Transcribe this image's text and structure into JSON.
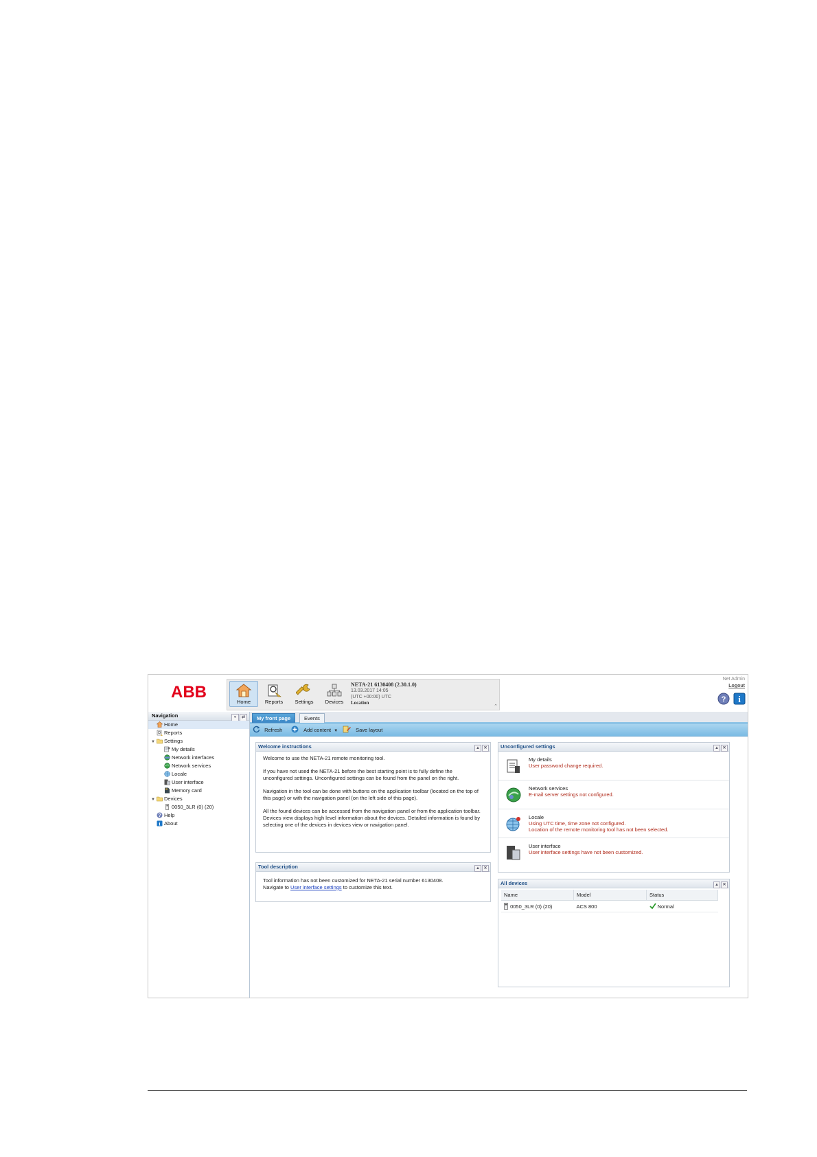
{
  "header": {
    "logo": "ABB",
    "toolbar": [
      {
        "label": "Home",
        "icon": "home-icon"
      },
      {
        "label": "Reports",
        "icon": "reports-icon"
      },
      {
        "label": "Settings",
        "icon": "wrench-icon"
      },
      {
        "label": "Devices",
        "icon": "devices-icon"
      }
    ],
    "device_title": "NETA-21 6130408 (2.30.1.0)",
    "datetime": "13.03.2017 14:05",
    "timezone": "(UTC +00:00) UTC",
    "location": "Location",
    "user_name": "Net Admin",
    "logout": "Logout"
  },
  "nav": {
    "title": "Navigation",
    "items": [
      {
        "label": "Home"
      },
      {
        "label": "Reports"
      },
      {
        "label": "Settings"
      },
      {
        "label": "My details"
      },
      {
        "label": "Network interfaces"
      },
      {
        "label": "Network services"
      },
      {
        "label": "Locale"
      },
      {
        "label": "User interface"
      },
      {
        "label": "Memory card"
      },
      {
        "label": "Devices"
      },
      {
        "label": "0050_3LR (0) (20)"
      },
      {
        "label": "Help"
      },
      {
        "label": "About"
      }
    ]
  },
  "tabs": [
    {
      "label": "My front page"
    },
    {
      "label": "Events"
    }
  ],
  "actions": {
    "refresh": "Refresh",
    "add_content": "Add content",
    "save_layout": "Save layout"
  },
  "welcome": {
    "title": "Welcome instructions",
    "p1": "Welcome to use the NETA-21 remote monitoring tool.",
    "p2": "If you have not used the NETA-21 before the best starting point is to fully define the unconfigured settings. Unconfigured settings can be found from the panel on the right.",
    "p3": "Navigation in the tool can be done with buttons on the application toolbar (located on the top of this page) or with the navigation panel (on the left side of this page).",
    "p4": "All the found devices can be accessed from the navigation panel or from the application toolbar. Devices view displays high level information about the devices. Detailed information is found by selecting one of the devices in devices view or navigation panel."
  },
  "tool": {
    "title": "Tool description",
    "line1": "Tool information has not been customized for NETA-21 serial number 6130408.",
    "nav_prefix": "Navigate to",
    "link": "User interface settings",
    "nav_suffix": "to customize this text."
  },
  "unconfigured": {
    "title": "Unconfigured settings",
    "items": [
      {
        "name": "My details",
        "w1": "User password change required.",
        "w2": ""
      },
      {
        "name": "Network services",
        "w1": "E-mail server settings not configured.",
        "w2": ""
      },
      {
        "name": "Locale",
        "w1": "Using UTC time, time zone not configured.",
        "w2": "Location of the remote monitoring tool has not been selected."
      },
      {
        "name": "User interface",
        "w1": "User interface settings have not been customized.",
        "w2": ""
      }
    ]
  },
  "all_devices": {
    "title": "All devices",
    "columns": [
      "Name",
      "Model",
      "Status"
    ],
    "rows": [
      {
        "name": "0050_3LR (0) (20)",
        "model": "ACS 800",
        "status": "Normal"
      }
    ]
  },
  "colors": {
    "brand_red": "#e2001a",
    "accent_blue": "#3b87c5",
    "warning_text": "#b02a1a"
  }
}
